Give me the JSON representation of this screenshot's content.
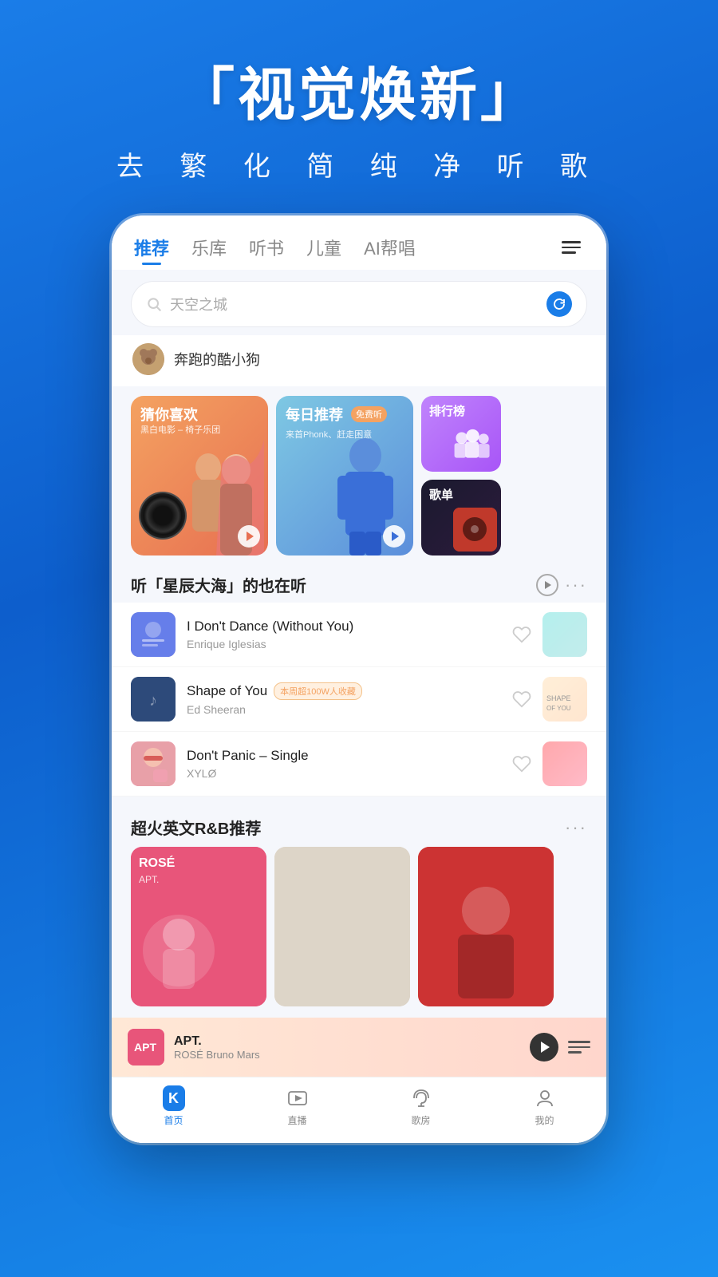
{
  "hero": {
    "title": "「视觉焕新」",
    "subtitle": "去 繁 化 简   纯 净 听 歌"
  },
  "nav": {
    "items": [
      {
        "label": "推荐",
        "active": true
      },
      {
        "label": "乐库",
        "active": false
      },
      {
        "label": "听书",
        "active": false
      },
      {
        "label": "儿童",
        "active": false
      },
      {
        "label": "AI帮唱",
        "active": false
      }
    ]
  },
  "search": {
    "placeholder": "天空之城"
  },
  "user": {
    "name": "奔跑的酷小狗"
  },
  "cards": [
    {
      "label": "猜你喜欢",
      "sublabel": "黑白电影 – 椅子乐团"
    },
    {
      "label": "每日推荐",
      "badge": "免费听",
      "sublabel": "来首Phonk、赶走困意"
    },
    {
      "label": "排行榜"
    },
    {
      "label": "歌单"
    }
  ],
  "section1": {
    "title": "听「星辰大海」的也在听"
  },
  "songs": [
    {
      "title": "I Don't Dance (Without You)",
      "artist": "Enrique Iglesias",
      "badge": ""
    },
    {
      "title": "Shape of You",
      "artist": "Ed Sheeran",
      "badge": "本周超100W人收藏"
    },
    {
      "title": "Don't Panic – Single",
      "artist": "XYLØ",
      "badge": ""
    }
  ],
  "section2": {
    "title": "超火英文R&B推荐"
  },
  "now_playing": {
    "title": "APT.",
    "artist": "ROSÉ Bruno Mars"
  },
  "bottom_nav": [
    {
      "label": "首页",
      "active": true,
      "icon": "K"
    },
    {
      "label": "直播",
      "active": false
    },
    {
      "label": "歌房",
      "active": false
    },
    {
      "label": "我的",
      "active": false
    }
  ]
}
